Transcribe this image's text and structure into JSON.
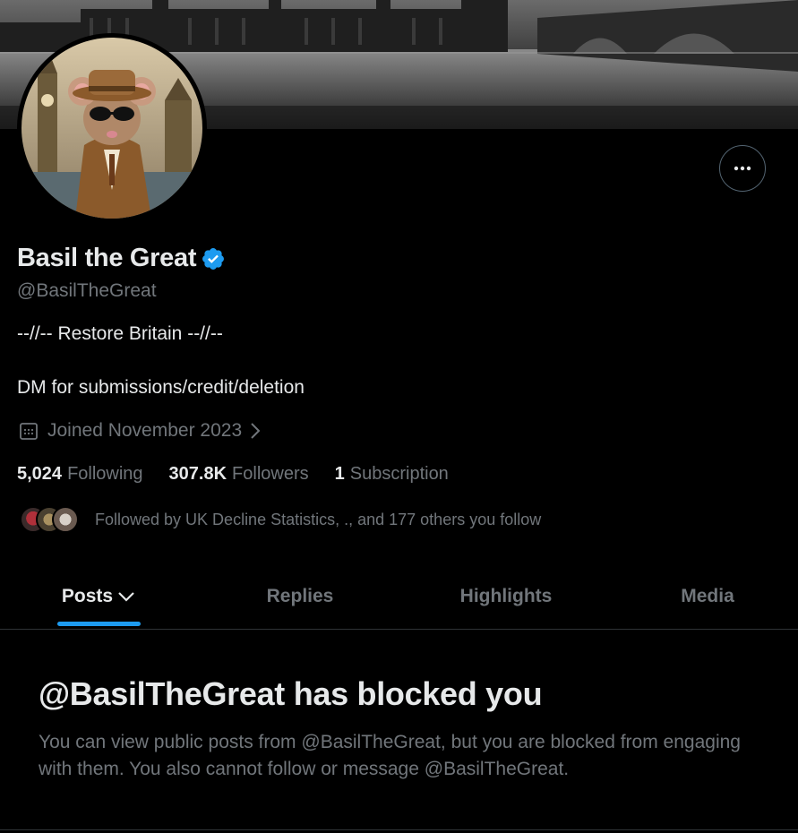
{
  "profile": {
    "name": "Basil the Great",
    "handle": "@BasilTheGreat",
    "bio_line1": "--//-- Restore Britain --//--",
    "bio_line2": "DM for submissions/credit/deletion",
    "joined": "Joined November 2023",
    "verified": true
  },
  "stats": {
    "following_count": "5,024",
    "following_label": "Following",
    "followers_count": "307.8K",
    "followers_label": "Followers",
    "subscription_count": "1",
    "subscription_label": "Subscription"
  },
  "followed_by": "Followed by UK Decline Statistics, ., and 177 others you follow",
  "tabs": [
    {
      "label": "Posts",
      "active": true
    },
    {
      "label": "Replies",
      "active": false
    },
    {
      "label": "Highlights",
      "active": false
    },
    {
      "label": "Media",
      "active": false
    }
  ],
  "blocked": {
    "title": "@BasilTheGreat has blocked you",
    "description": "You can view public posts from @BasilTheGreat, but you are blocked from engaging with them. You also cannot follow or message @BasilTheGreat."
  },
  "colors": {
    "accent": "#1d9bf0",
    "background": "#000000",
    "text_primary": "#e7e9ea",
    "text_secondary": "#71767b",
    "border": "#2f3336"
  },
  "icons": {
    "more": "more-horizontal-icon",
    "verified": "verified-badge-icon",
    "calendar": "calendar-icon",
    "chevron": "chevron-right-icon",
    "tab_dropdown": "chevron-down-icon"
  }
}
